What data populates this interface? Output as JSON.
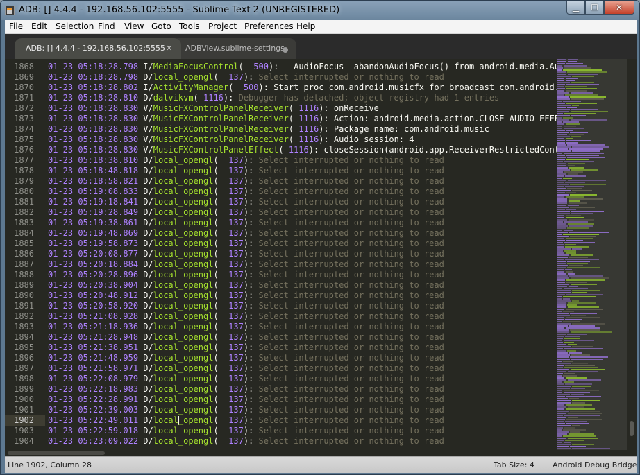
{
  "window": {
    "title": "ADB: [] 4.4.4 - 192.168.56.102:5555 - Sublime Text 2 (UNREGISTERED)",
    "minimize": "▁",
    "maximize": "☐",
    "close": "✕"
  },
  "menu": [
    "File",
    "Edit",
    "Selection",
    "Find",
    "View",
    "Goto",
    "Tools",
    "Project",
    "Preferences",
    "Help"
  ],
  "menu_underline": [
    "F",
    "E",
    "S",
    "i",
    "V",
    "G",
    "T",
    "P",
    "n",
    "H"
  ],
  "tabs": [
    {
      "label": "ADB: [] 4.4.4 - 192.168.56.102:5555",
      "active": true,
      "close": "✕"
    },
    {
      "label": "ADBView.sublime-settings",
      "active": false
    }
  ],
  "editor": {
    "partial_line": "                                                                     ",
    "lines": [
      {
        "n": "1868",
        "ts": "01-23 05:18:28.798",
        "lvl": "I",
        "tag": "MediaFocusControl",
        "pid": "500",
        "msg": "  AudioFocus  abandonAudioFocus() from android.media.AudioM",
        "dim": false
      },
      {
        "n": "1869",
        "ts": "01-23 05:18:28.798",
        "lvl": "D",
        "tag": "local_opengl",
        "pid": "137",
        "msg": "Select interrupted or nothing to read",
        "dim": true
      },
      {
        "n": "1870",
        "ts": "01-23 05:18:28.802",
        "lvl": "I",
        "tag": "ActivityManager",
        "pid": "500",
        "msg": "Start proc com.android.musicfx for broadcast com.android.musi",
        "dim": false
      },
      {
        "n": "1871",
        "ts": "01-23 05:18:28.810",
        "lvl": "D",
        "tag": "dalvikvm",
        "pid": "1116",
        "msg": "Debugger has detached; object registry had 1 entries",
        "dim": true
      },
      {
        "n": "1872",
        "ts": "01-23 05:18:28.830",
        "lvl": "V",
        "tag": "MusicFXControlPanelReceiver",
        "pid": "1116",
        "msg": "onReceive",
        "dim": false
      },
      {
        "n": "1873",
        "ts": "01-23 05:18:28.830",
        "lvl": "V",
        "tag": "MusicFXControlPanelReceiver",
        "pid": "1116",
        "msg": "Action: android.media.action.CLOSE_AUDIO_EFFECT_",
        "dim": false
      },
      {
        "n": "1874",
        "ts": "01-23 05:18:28.830",
        "lvl": "V",
        "tag": "MusicFXControlPanelReceiver",
        "pid": "1116",
        "msg": "Package name: com.android.music",
        "dim": false
      },
      {
        "n": "1875",
        "ts": "01-23 05:18:28.830",
        "lvl": "V",
        "tag": "MusicFXControlPanelReceiver",
        "pid": "1116",
        "msg": "Audio session: 4",
        "dim": false
      },
      {
        "n": "1876",
        "ts": "01-23 05:18:28.830",
        "lvl": "V",
        "tag": "MusicFXControlPanelEffect",
        "pid": "1116",
        "msg": "closeSession(android.app.ReceiverRestrictedContext",
        "dim": false
      },
      {
        "n": "1877",
        "ts": "01-23 05:18:38.810",
        "lvl": "D",
        "tag": "local_opengl",
        "pid": "137",
        "msg": "Select interrupted or nothing to read",
        "dim": true
      },
      {
        "n": "1878",
        "ts": "01-23 05:18:48.818",
        "lvl": "D",
        "tag": "local_opengl",
        "pid": "137",
        "msg": "Select interrupted or nothing to read",
        "dim": true
      },
      {
        "n": "1879",
        "ts": "01-23 05:18:58.821",
        "lvl": "D",
        "tag": "local_opengl",
        "pid": "137",
        "msg": "Select interrupted or nothing to read",
        "dim": true
      },
      {
        "n": "1880",
        "ts": "01-23 05:19:08.833",
        "lvl": "D",
        "tag": "local_opengl",
        "pid": "137",
        "msg": "Select interrupted or nothing to read",
        "dim": true
      },
      {
        "n": "1881",
        "ts": "01-23 05:19:18.841",
        "lvl": "D",
        "tag": "local_opengl",
        "pid": "137",
        "msg": "Select interrupted or nothing to read",
        "dim": true
      },
      {
        "n": "1882",
        "ts": "01-23 05:19:28.849",
        "lvl": "D",
        "tag": "local_opengl",
        "pid": "137",
        "msg": "Select interrupted or nothing to read",
        "dim": true
      },
      {
        "n": "1883",
        "ts": "01-23 05:19:38.861",
        "lvl": "D",
        "tag": "local_opengl",
        "pid": "137",
        "msg": "Select interrupted or nothing to read",
        "dim": true
      },
      {
        "n": "1884",
        "ts": "01-23 05:19:48.869",
        "lvl": "D",
        "tag": "local_opengl",
        "pid": "137",
        "msg": "Select interrupted or nothing to read",
        "dim": true
      },
      {
        "n": "1885",
        "ts": "01-23 05:19:58.873",
        "lvl": "D",
        "tag": "local_opengl",
        "pid": "137",
        "msg": "Select interrupted or nothing to read",
        "dim": true
      },
      {
        "n": "1886",
        "ts": "01-23 05:20:08.877",
        "lvl": "D",
        "tag": "local_opengl",
        "pid": "137",
        "msg": "Select interrupted or nothing to read",
        "dim": true
      },
      {
        "n": "1887",
        "ts": "01-23 05:20:18.884",
        "lvl": "D",
        "tag": "local_opengl",
        "pid": "137",
        "msg": "Select interrupted or nothing to read",
        "dim": true
      },
      {
        "n": "1888",
        "ts": "01-23 05:20:28.896",
        "lvl": "D",
        "tag": "local_opengl",
        "pid": "137",
        "msg": "Select interrupted or nothing to read",
        "dim": true
      },
      {
        "n": "1889",
        "ts": "01-23 05:20:38.904",
        "lvl": "D",
        "tag": "local_opengl",
        "pid": "137",
        "msg": "Select interrupted or nothing to read",
        "dim": true
      },
      {
        "n": "1890",
        "ts": "01-23 05:20:48.912",
        "lvl": "D",
        "tag": "local_opengl",
        "pid": "137",
        "msg": "Select interrupted or nothing to read",
        "dim": true
      },
      {
        "n": "1891",
        "ts": "01-23 05:20:58.920",
        "lvl": "D",
        "tag": "local_opengl",
        "pid": "137",
        "msg": "Select interrupted or nothing to read",
        "dim": true
      },
      {
        "n": "1892",
        "ts": "01-23 05:21:08.928",
        "lvl": "D",
        "tag": "local_opengl",
        "pid": "137",
        "msg": "Select interrupted or nothing to read",
        "dim": true
      },
      {
        "n": "1893",
        "ts": "01-23 05:21:18.936",
        "lvl": "D",
        "tag": "local_opengl",
        "pid": "137",
        "msg": "Select interrupted or nothing to read",
        "dim": true
      },
      {
        "n": "1894",
        "ts": "01-23 05:21:28.948",
        "lvl": "D",
        "tag": "local_opengl",
        "pid": "137",
        "msg": "Select interrupted or nothing to read",
        "dim": true
      },
      {
        "n": "1895",
        "ts": "01-23 05:21:38.951",
        "lvl": "D",
        "tag": "local_opengl",
        "pid": "137",
        "msg": "Select interrupted or nothing to read",
        "dim": true
      },
      {
        "n": "1896",
        "ts": "01-23 05:21:48.959",
        "lvl": "D",
        "tag": "local_opengl",
        "pid": "137",
        "msg": "Select interrupted or nothing to read",
        "dim": true
      },
      {
        "n": "1897",
        "ts": "01-23 05:21:58.971",
        "lvl": "D",
        "tag": "local_opengl",
        "pid": "137",
        "msg": "Select interrupted or nothing to read",
        "dim": true
      },
      {
        "n": "1898",
        "ts": "01-23 05:22:08.979",
        "lvl": "D",
        "tag": "local_opengl",
        "pid": "137",
        "msg": "Select interrupted or nothing to read",
        "dim": true
      },
      {
        "n": "1899",
        "ts": "01-23 05:22:18.983",
        "lvl": "D",
        "tag": "local_opengl",
        "pid": "137",
        "msg": "Select interrupted or nothing to read",
        "dim": true
      },
      {
        "n": "1900",
        "ts": "01-23 05:22:28.991",
        "lvl": "D",
        "tag": "local_opengl",
        "pid": "137",
        "msg": "Select interrupted or nothing to read",
        "dim": true
      },
      {
        "n": "1901",
        "ts": "01-23 05:22:39.003",
        "lvl": "D",
        "tag": "local_opengl",
        "pid": "137",
        "msg": "Select interrupted or nothing to read",
        "dim": true
      },
      {
        "n": "1902",
        "ts": "01-23 05:22:49.011",
        "lvl": "D",
        "tag": "local_opengl",
        "pid": "137",
        "msg": "Select interrupted or nothing to read",
        "dim": true,
        "current": true
      },
      {
        "n": "1903",
        "ts": "01-23 05:22:59.018",
        "lvl": "D",
        "tag": "local_opengl",
        "pid": "137",
        "msg": "Select interrupted or nothing to read",
        "dim": true
      },
      {
        "n": "1904",
        "ts": "01-23 05:23:09.022",
        "lvl": "D",
        "tag": "local_opengl",
        "pid": "137",
        "msg": "Select interrupted or nothing to read",
        "dim": true
      }
    ]
  },
  "status": {
    "position": "Line 1902, Column 28",
    "tab_size": "Tab Size: 4",
    "syntax": "Android Debug Bridge"
  },
  "colors": {
    "editor_bg": "#272822",
    "timestamp": "#ae81ff",
    "tag": "#a6e22e",
    "comment": "#75715e",
    "text": "#f8f8f2"
  }
}
